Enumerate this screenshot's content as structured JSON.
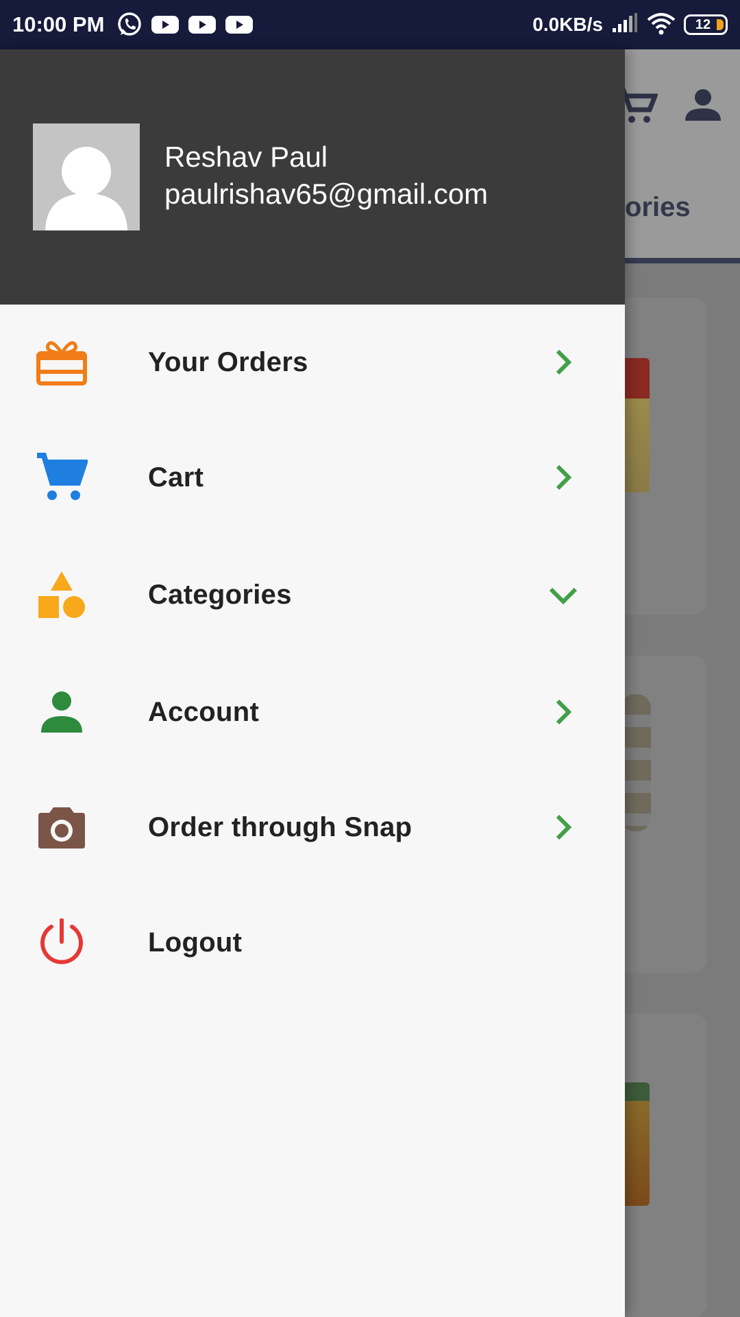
{
  "status_bar": {
    "time": "10:00 PM",
    "net_speed": "0.0KB/s",
    "battery": "12",
    "notification_icons": [
      "whatsapp-icon",
      "youtube-icon",
      "youtube-icon",
      "youtube-icon"
    ]
  },
  "background": {
    "tab_text": "ories"
  },
  "drawer": {
    "user_name": "Reshav Paul",
    "user_email": "paulrishav65@gmail.com",
    "items": [
      {
        "label": "Your Orders",
        "icon": "gift-box-icon",
        "icon_color": "#f07d17",
        "indicator": "chevron-right"
      },
      {
        "label": "Cart",
        "icon": "shopping-cart-icon",
        "icon_color": "#1e7fe0",
        "indicator": "chevron-right"
      },
      {
        "label": "Categories",
        "icon": "shapes-icon",
        "icon_color": "#f7a91b",
        "indicator": "chevron-down"
      },
      {
        "label": "Account",
        "icon": "person-icon",
        "icon_color": "#2e8b3e",
        "indicator": "chevron-right"
      },
      {
        "label": "Order through Snap",
        "icon": "camera-icon",
        "icon_color": "#7a5548",
        "indicator": "chevron-right"
      },
      {
        "label": "Logout",
        "icon": "power-icon",
        "icon_color": "#e53935",
        "indicator": ""
      }
    ],
    "chevron_color": "#43a047"
  }
}
